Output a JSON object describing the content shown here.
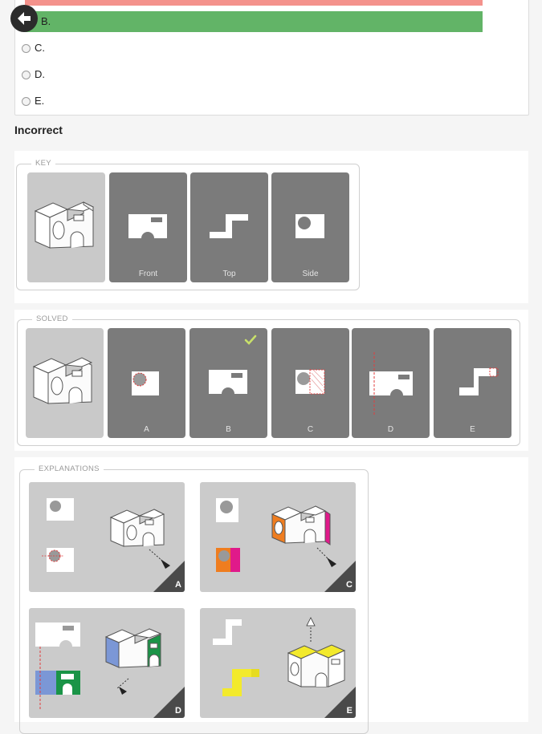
{
  "question": {
    "options": [
      {
        "key": "option-b",
        "label": "B.",
        "state": "correct"
      },
      {
        "key": "option-c",
        "label": "C."
      },
      {
        "key": "option-d",
        "label": "D."
      },
      {
        "key": "option-e",
        "label": "E."
      }
    ],
    "colors": {
      "wrong": "#f4928c",
      "correct": "#62b467"
    }
  },
  "result": {
    "text": "Incorrect"
  },
  "key_section": {
    "legend": "KEY",
    "tiles": [
      {
        "label": ""
      },
      {
        "label": "Front"
      },
      {
        "label": "Top"
      },
      {
        "label": "Side"
      }
    ]
  },
  "solved_section": {
    "legend": "SOLVED",
    "tiles": [
      {
        "label": ""
      },
      {
        "label": "A"
      },
      {
        "label": "B",
        "checked": true
      },
      {
        "label": "C"
      },
      {
        "label": "D"
      },
      {
        "label": "E"
      }
    ],
    "check_color": "#c8e06a"
  },
  "explanations_section": {
    "legend": "EXPLANATIONS",
    "panels": [
      {
        "letter": "A"
      },
      {
        "letter": "C"
      },
      {
        "letter": "D"
      },
      {
        "letter": "E"
      }
    ],
    "colors": {
      "orange": "#ef7d1f",
      "magenta": "#e01a8a",
      "blue": "#7b97d6",
      "green": "#1a9447",
      "yellow": "#f3ea2c",
      "red": "#e03c3c"
    }
  },
  "icons": {
    "back": "back-arrow-icon",
    "check": "check-icon"
  }
}
